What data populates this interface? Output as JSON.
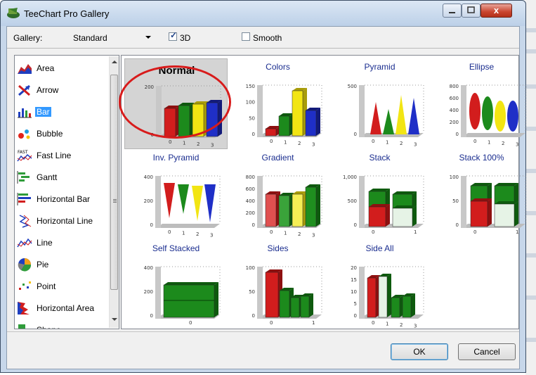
{
  "window": {
    "title": "TeeChart Pro Gallery",
    "close_glyph": "x"
  },
  "toolbar": {
    "gallery_label": "Gallery:",
    "gallery_value": "Standard",
    "check_3d": "3D",
    "check_3d_checked": true,
    "check_smooth": "Smooth",
    "check_smooth_checked": false
  },
  "sidebar": {
    "items": [
      {
        "label": "Area",
        "icon": "area-chart-icon"
      },
      {
        "label": "Arrow",
        "icon": "arrow-chart-icon"
      },
      {
        "label": "Bar",
        "icon": "bar-chart-icon",
        "selected": true
      },
      {
        "label": "Bubble",
        "icon": "bubble-chart-icon"
      },
      {
        "label": "Fast Line",
        "icon": "fast-line-icon"
      },
      {
        "label": "Gantt",
        "icon": "gantt-chart-icon"
      },
      {
        "label": "Horizontal Bar",
        "icon": "horizontal-bar-icon"
      },
      {
        "label": "Horizontal Line",
        "icon": "horizontal-line-icon"
      },
      {
        "label": "Line",
        "icon": "line-chart-icon"
      },
      {
        "label": "Pie",
        "icon": "pie-chart-icon"
      },
      {
        "label": "Point",
        "icon": "point-chart-icon"
      },
      {
        "label": "Horizontal Area",
        "icon": "horizontal-area-icon"
      },
      {
        "label": "Shape",
        "icon": "shape-chart-icon"
      }
    ]
  },
  "gallery": {
    "tiles": [
      {
        "name": "Normal",
        "selected": true,
        "ticks": [
          "200",
          "0"
        ],
        "xticks": [
          "0",
          "1",
          "2",
          "3"
        ]
      },
      {
        "name": "Colors",
        "ticks": [
          "150",
          "100",
          "50",
          "0"
        ],
        "xticks": [
          "0",
          "1",
          "2",
          "3"
        ]
      },
      {
        "name": "Pyramid",
        "ticks": [
          "500",
          "0"
        ],
        "xticks": [
          "0",
          "1",
          "2",
          "3"
        ]
      },
      {
        "name": "Ellipse",
        "ticks": [
          "800",
          "600",
          "400",
          "200",
          "0"
        ],
        "xticks": [
          "0",
          "1",
          "2",
          "3"
        ]
      },
      {
        "name": "Inv. Pyramid",
        "ticks": [
          "400",
          "200",
          "0"
        ],
        "xticks": [
          "0",
          "1",
          "2",
          "3"
        ]
      },
      {
        "name": "Gradient",
        "ticks": [
          "800",
          "600",
          "400",
          "200",
          "0"
        ],
        "xticks": [
          "0",
          "1",
          "2",
          "3"
        ]
      },
      {
        "name": "Stack",
        "ticks": [
          "1,000",
          "500",
          "0"
        ],
        "xticks": [
          "0",
          "1"
        ]
      },
      {
        "name": "Stack 100%",
        "ticks": [
          "100",
          "50",
          "0"
        ],
        "xticks": [
          "0",
          "1"
        ]
      },
      {
        "name": "Self Stacked",
        "ticks": [
          "400",
          "200",
          "0"
        ],
        "xticks": [
          "0"
        ]
      },
      {
        "name": "Sides",
        "ticks": [
          "100",
          "50",
          "0"
        ],
        "xticks": [
          "0",
          "1"
        ]
      },
      {
        "name": "Side All",
        "ticks": [
          "20",
          "15",
          "10",
          "5",
          "0"
        ],
        "xticks": [
          "0",
          "1",
          "2",
          "3"
        ]
      }
    ]
  },
  "buttons": {
    "ok": "OK",
    "cancel": "Cancel"
  },
  "colors": {
    "selection": "#3399ff",
    "title_link": "#1a2d8f",
    "highlight_ring": "#d81b1b"
  }
}
